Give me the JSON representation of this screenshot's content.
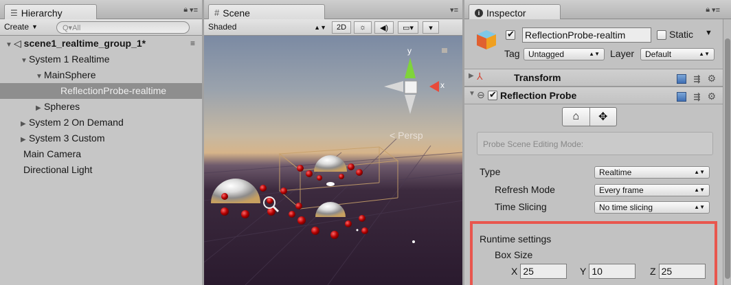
{
  "hierarchy": {
    "tab_title": "Hierarchy",
    "create_label": "Create",
    "search_placeholder": "Q▾All",
    "items": [
      {
        "label": "scene1_realtime_group_1*",
        "depth": 0,
        "arrow": "▼",
        "selected": false,
        "root": true
      },
      {
        "label": "System 1 Realtime",
        "depth": 1,
        "arrow": "▼",
        "selected": false
      },
      {
        "label": "MainSphere",
        "depth": 2,
        "arrow": "▼",
        "selected": false
      },
      {
        "label": "ReflectionProbe-realtime",
        "depth": 3,
        "arrow": "",
        "selected": true
      },
      {
        "label": "Spheres",
        "depth": 2,
        "arrow": "▶",
        "selected": false
      },
      {
        "label": "System 2 On Demand",
        "depth": 1,
        "arrow": "▶",
        "selected": false
      },
      {
        "label": "System 3 Custom",
        "depth": 1,
        "arrow": "▶",
        "selected": false
      },
      {
        "label": "Main Camera",
        "depth": 1,
        "arrow": "",
        "selected": false
      },
      {
        "label": "Directional Light",
        "depth": 1,
        "arrow": "",
        "selected": false
      }
    ]
  },
  "scene": {
    "tab_title": "Scene",
    "shading_mode": "Shaded",
    "btn_2d": "2D",
    "projection_label": "< Persp",
    "axis_y": "y",
    "axis_x": "x"
  },
  "inspector": {
    "tab_title": "Inspector",
    "object_name": "ReflectionProbe-realtim",
    "static_label": "Static",
    "tag_label": "Tag",
    "tag_value": "Untagged",
    "layer_label": "Layer",
    "layer_value": "Default",
    "transform_title": "Transform",
    "probe_title": "Reflection Probe",
    "help_text": "Probe Scene Editing Mode:",
    "type_label": "Type",
    "type_value": "Realtime",
    "refresh_label": "Refresh Mode",
    "refresh_value": "Every frame",
    "slicing_label": "Time Slicing",
    "slicing_value": "No time slicing",
    "runtime_label": "Runtime settings",
    "boxsize_label": "Box Size",
    "x_label": "X",
    "x_value": "25",
    "y_label": "Y",
    "y_value": "10",
    "z_label": "Z",
    "z_value": "25",
    "highlight_color": "#e8564e"
  }
}
